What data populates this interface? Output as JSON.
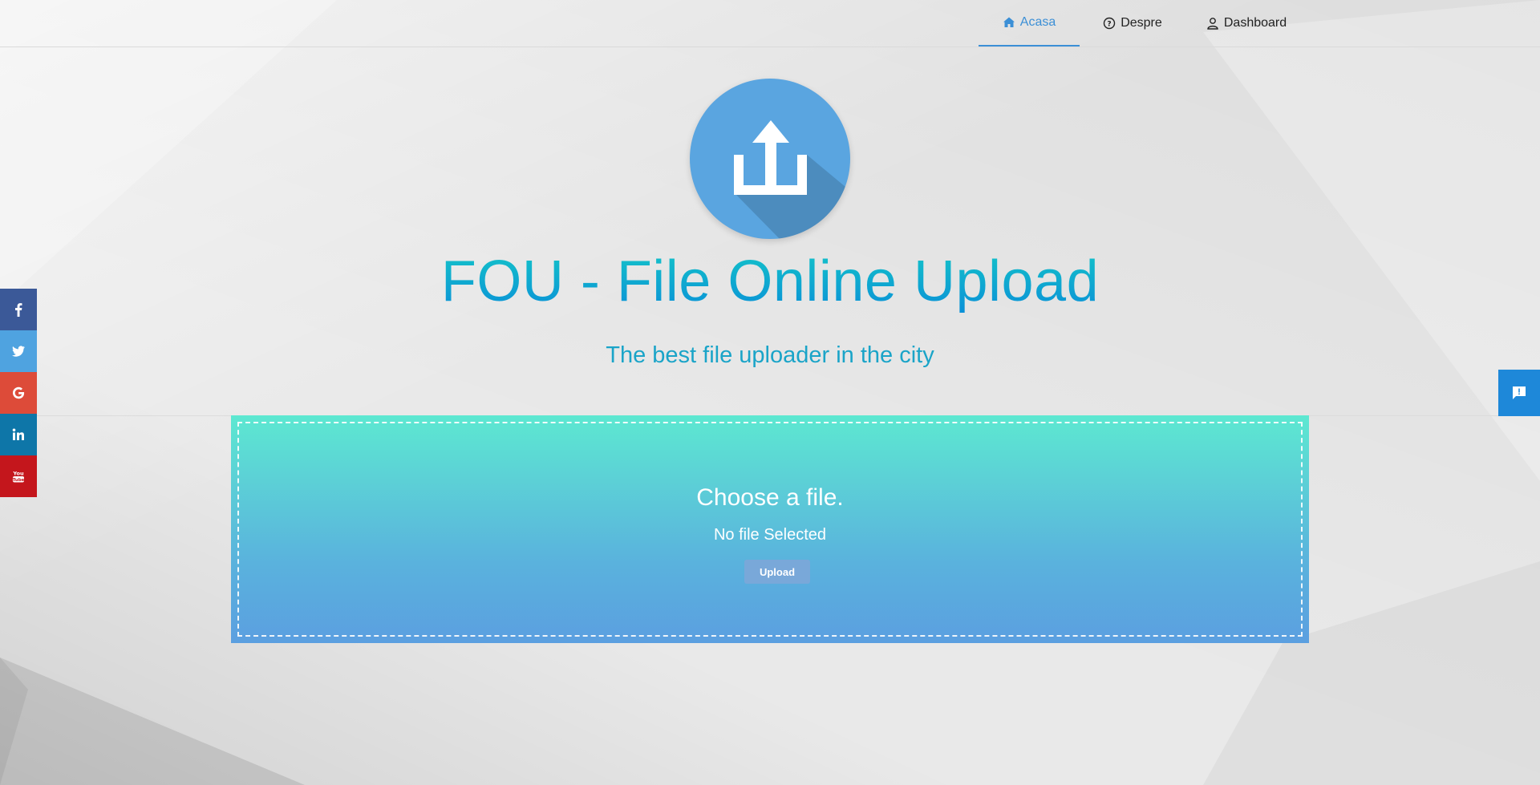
{
  "nav": {
    "items": [
      {
        "label": "Acasa",
        "icon": "home-icon",
        "active": true
      },
      {
        "label": "Despre",
        "icon": "question-circle-icon",
        "active": false
      },
      {
        "label": "Dashboard",
        "icon": "user-icon",
        "active": false
      }
    ]
  },
  "hero": {
    "title": "FOU - File Online Upload",
    "subtitle": "The best file uploader in the city",
    "logo_icon": "upload-icon"
  },
  "upload": {
    "choose_label": "Choose a file.",
    "status": "No file Selected",
    "button_label": "Upload"
  },
  "social": [
    {
      "name": "facebook",
      "icon": "facebook-icon",
      "color": "#3b5998"
    },
    {
      "name": "twitter",
      "icon": "twitter-icon",
      "color": "#4fa3e0"
    },
    {
      "name": "google",
      "icon": "google-icon",
      "color": "#dd4b39"
    },
    {
      "name": "linkedin",
      "icon": "linkedin-icon",
      "color": "#0e76a8"
    },
    {
      "name": "youtube",
      "icon": "youtube-icon",
      "color": "#c4161c"
    }
  ],
  "feedback": {
    "icon": "feedback-icon",
    "color": "#1e88d9"
  },
  "colors": {
    "accent": "#3b8fd6",
    "upload_gradient_top": "#5de8d1",
    "upload_gradient_bottom": "#5b9fe0",
    "title_gradient_top": "#14c4c8",
    "title_gradient_bottom": "#0a8fd8",
    "subtitle": "#1aa4c8"
  }
}
